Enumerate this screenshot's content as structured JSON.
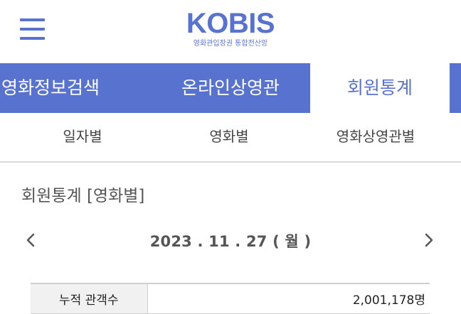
{
  "header": {
    "logo_text": "KOBIS",
    "logo_subtitle": "영화관입장권 통합전산망",
    "menu_icon": "hamburger-menu-icon"
  },
  "main_nav": {
    "tabs": [
      {
        "label": "영화정보검색",
        "active": false
      },
      {
        "label": "온라인상영관",
        "active": false
      },
      {
        "label": "회원통계",
        "active": true
      }
    ]
  },
  "sub_nav": {
    "tabs": [
      {
        "label": "일자별"
      },
      {
        "label": "영화별"
      },
      {
        "label": "영화상영관별"
      }
    ]
  },
  "page": {
    "title": "회원통계 [영화별]"
  },
  "date_nav": {
    "date": "2023 . 11 . 27 ( 월 )",
    "prev_icon": "chevron-left-icon",
    "next_icon": "chevron-right-icon"
  },
  "stats": {
    "rows": [
      {
        "label": "누적 관객수",
        "value": "2,001,178명"
      }
    ]
  },
  "colors": {
    "accent": "#5872cf",
    "divider": "#d9d9d9",
    "table_header_bg": "#f1f1f1"
  }
}
